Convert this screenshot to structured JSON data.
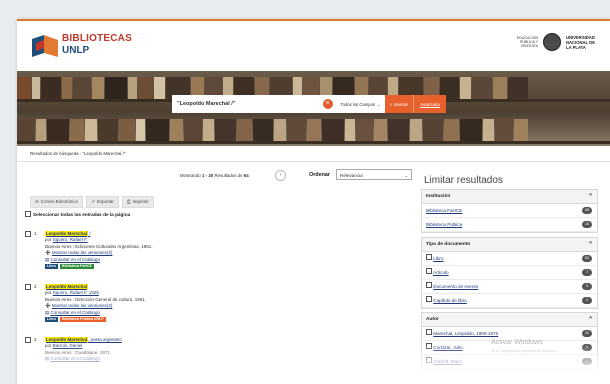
{
  "header": {
    "logo_line1": "BIBLIOTECAS",
    "logo_line2": "UNLP",
    "edu_text": "EDUCACIÓN PÚBLICA Y GRATUITA",
    "unlp_text": "UNIVERSIDAD NACIONAL DE LA PLATA"
  },
  "search": {
    "query": "\"Leopoldo Marechal /\"",
    "field_select": "Todos los Campos",
    "search_label": "Buscar",
    "advanced_label": "Avanzado"
  },
  "breadcrumb": "Resultados de búsqueda - \"Leopoldo Marechal /\"",
  "results_header": {
    "showing_prefix": "Mostrando",
    "showing_range": "1 - 20",
    "showing_mid": "Resultados de",
    "showing_total": "64",
    "sort_label": "Ordenar",
    "sort_value": "Relevancia"
  },
  "toolbar": {
    "email": "Correo Electrónico",
    "export": "Exportar",
    "print": "Imprimir"
  },
  "select_all": "Seleccionar todas las entradas de la página",
  "results": [
    {
      "num": "1",
      "title": "Leopoldo Marechal",
      "title_suffix": " /",
      "by": "por",
      "author": "Squirru, Rafael F.",
      "publisher": "Buenos Aires : Ediciones Culturales Argentinas, 1961.",
      "versions": "Mostrar todas las versiones(2)",
      "catalog": "Consultar en el Catálogo",
      "badges": [
        "Libro",
        "Biblioteca FaHCE"
      ]
    },
    {
      "num": "2",
      "title": "Leopoldo Marechal",
      "title_suffix": "",
      "by": "por",
      "author": "Squirru, Rafael F. 1925",
      "publisher": "Buenos Aires : Dirección General de cultura, 1961.",
      "versions": "Mostrar todas las versiones(2)",
      "catalog": "Consultar en el Catálogo",
      "badges": [
        "Libro",
        "Biblioteca Pública UNLP"
      ]
    },
    {
      "num": "3",
      "title": "Leopoldo Marechal",
      "title_suffix": ", poeta argentino",
      "by": "por",
      "author": "Barrois, Daniel",
      "publisher": "Buenos Aires : Guadalupe, 1971.",
      "versions": "",
      "catalog": "Consultar en el Catálogo",
      "badges": []
    }
  ],
  "limit_title": "Limitar resultados",
  "facets": [
    {
      "heading": "Institución",
      "items": [
        {
          "label": "Biblioteca FaHCE",
          "count": "49"
        },
        {
          "label": "Biblioteca Pública",
          "count": "15"
        }
      ]
    },
    {
      "heading": "Tipo de documento",
      "items": [
        {
          "label": "Libro",
          "count": "52"
        },
        {
          "label": "Artículo",
          "count": "7"
        },
        {
          "label": "Documento de evento",
          "count": "3"
        },
        {
          "label": "Capítulo de libro",
          "count": "2"
        }
      ]
    },
    {
      "heading": "Autor",
      "items": [
        {
          "label": "Marechal, Leopoldo, 1900-1970",
          "count": "22"
        },
        {
          "label": "Cortázar, Julio",
          "count": "2"
        },
        {
          "label": "Goldoft, Mario",
          "count": "2"
        }
      ]
    }
  ],
  "watermark": {
    "title": "Activar Windows",
    "subtitle": "Ve a Configuración para activar Windows."
  },
  "colors": {
    "accent": "#e8602c",
    "highlight": "#ffe600",
    "link": "#1f3a7a",
    "badge_libro": "#1f4e79",
    "badge_fahce": "#2e8b3a",
    "badge_publica": "#e8602c"
  }
}
